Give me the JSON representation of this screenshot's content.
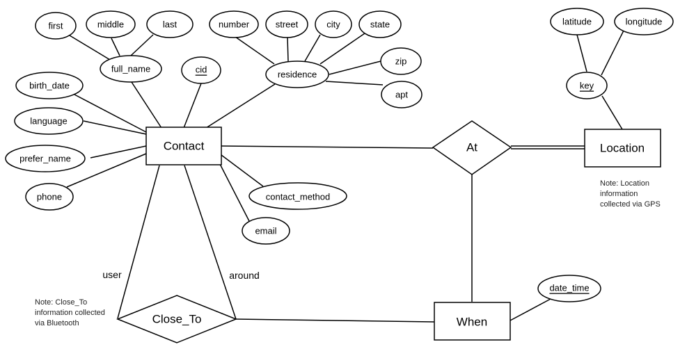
{
  "diagram": {
    "type": "er-diagram",
    "entities": [
      {
        "id": "contact",
        "label": "Contact"
      },
      {
        "id": "location",
        "label": "Location"
      },
      {
        "id": "when",
        "label": "When"
      }
    ],
    "relationships": [
      {
        "id": "at",
        "label": "At"
      },
      {
        "id": "close_to",
        "label": "Close_To"
      }
    ],
    "attributes": [
      {
        "id": "first",
        "label": "first",
        "key": false
      },
      {
        "id": "middle",
        "label": "middle",
        "key": false
      },
      {
        "id": "last",
        "label": "last",
        "key": false
      },
      {
        "id": "full_name",
        "label": "full_name",
        "key": false
      },
      {
        "id": "cid",
        "label": "cid",
        "key": true
      },
      {
        "id": "birth_date",
        "label": "birth_date",
        "key": false
      },
      {
        "id": "language",
        "label": "language",
        "key": false
      },
      {
        "id": "prefer_name",
        "label": "prefer_name",
        "key": false
      },
      {
        "id": "phone",
        "label": "phone",
        "key": false
      },
      {
        "id": "number",
        "label": "number",
        "key": false
      },
      {
        "id": "street",
        "label": "street",
        "key": false
      },
      {
        "id": "city",
        "label": "city",
        "key": false
      },
      {
        "id": "state",
        "label": "state",
        "key": false
      },
      {
        "id": "zip",
        "label": "zip",
        "key": false
      },
      {
        "id": "apt",
        "label": "apt",
        "key": false
      },
      {
        "id": "residence",
        "label": "residence",
        "key": false
      },
      {
        "id": "contact_method",
        "label": "contact_method",
        "key": false
      },
      {
        "id": "email",
        "label": "email",
        "key": false
      },
      {
        "id": "latitude",
        "label": "latitude",
        "key": false
      },
      {
        "id": "longitude",
        "label": "longitude",
        "key": false
      },
      {
        "id": "key",
        "label": "key",
        "key": true
      },
      {
        "id": "date_time",
        "label": "date_time",
        "key": true
      }
    ],
    "roles": {
      "user": "user",
      "around": "around"
    },
    "notes": {
      "location": [
        "Note: Location",
        "information",
        "collected via GPS"
      ],
      "close_to": [
        "Note: Close_To",
        "information collected",
        "via Bluetooth"
      ]
    },
    "edges": [
      [
        "first",
        "full_name"
      ],
      [
        "middle",
        "full_name"
      ],
      [
        "last",
        "full_name"
      ],
      [
        "full_name",
        "contact"
      ],
      [
        "cid",
        "contact"
      ],
      [
        "birth_date",
        "contact"
      ],
      [
        "language",
        "contact"
      ],
      [
        "prefer_name",
        "contact"
      ],
      [
        "phone",
        "contact"
      ],
      [
        "residence",
        "contact"
      ],
      [
        "contact_method",
        "contact"
      ],
      [
        "email",
        "contact"
      ],
      [
        "number",
        "residence"
      ],
      [
        "street",
        "residence"
      ],
      [
        "city",
        "residence"
      ],
      [
        "state",
        "residence"
      ],
      [
        "zip",
        "residence"
      ],
      [
        "apt",
        "residence"
      ],
      [
        "latitude",
        "key"
      ],
      [
        "longitude",
        "key"
      ],
      [
        "key",
        "location"
      ],
      [
        "contact",
        "at"
      ],
      [
        "at",
        "location",
        "total"
      ],
      [
        "at",
        "when"
      ],
      [
        "contact",
        "close_to",
        "user"
      ],
      [
        "contact",
        "close_to",
        "around"
      ],
      [
        "close_to",
        "when"
      ],
      [
        "date_time",
        "when"
      ]
    ]
  }
}
